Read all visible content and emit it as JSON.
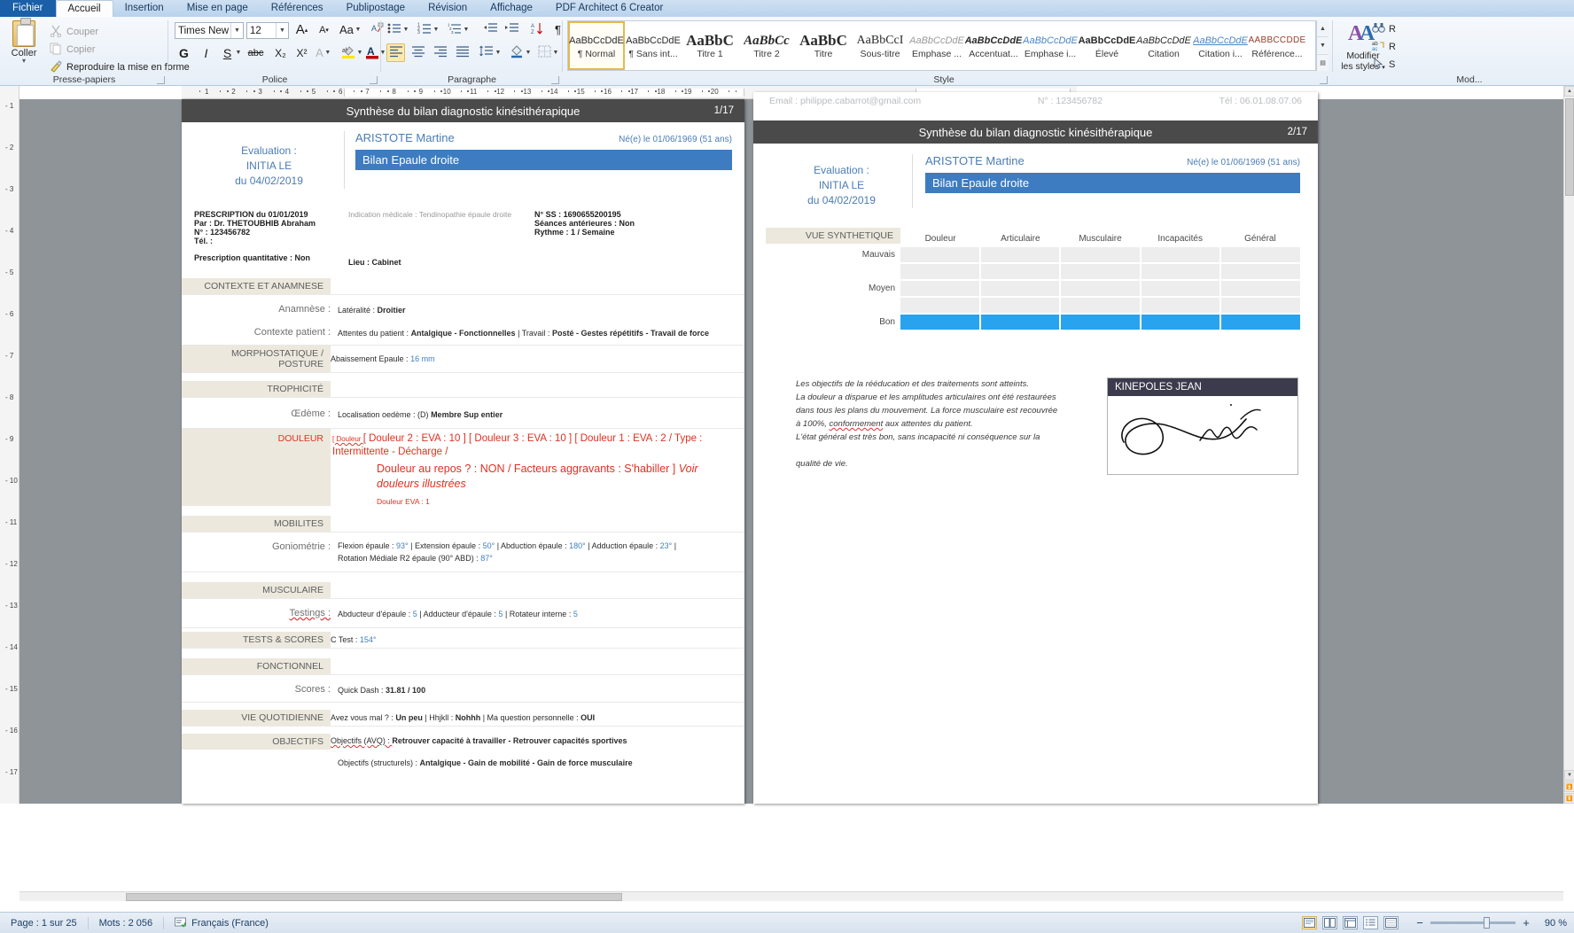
{
  "ribbon": {
    "tabs": [
      {
        "label": "Fichier",
        "kind": "file"
      },
      {
        "label": "Accueil",
        "kind": "active"
      },
      {
        "label": "Insertion",
        "kind": "normal"
      },
      {
        "label": "Mise en page",
        "kind": "normal"
      },
      {
        "label": "Références",
        "kind": "normal"
      },
      {
        "label": "Publipostage",
        "kind": "normal"
      },
      {
        "label": "Révision",
        "kind": "normal"
      },
      {
        "label": "Affichage",
        "kind": "normal"
      },
      {
        "label": "PDF Architect 6 Creator",
        "kind": "normal"
      }
    ],
    "clipboard": {
      "group_label": "Presse-papiers",
      "paste_label": "Coller",
      "cut_label": "Couper",
      "copy_label": "Copier",
      "format_painter_label": "Reproduire la mise en forme"
    },
    "font": {
      "group_label": "Police",
      "font_name": "Times New R",
      "font_size": "12",
      "grow_font": "A",
      "shrink_font": "A",
      "change_case": "Aa",
      "clear_format": "clear-formatting",
      "bold": "G",
      "italic": "I",
      "underline": "S",
      "strikethrough": "abc",
      "subscript": "X₂",
      "superscript": "X²",
      "text_effects": "A",
      "highlight": "ab",
      "font_color": "A"
    },
    "paragraph": {
      "group_label": "Paragraphe",
      "bullets": "bullet-list",
      "numbering": "numbered-list",
      "multilevel": "multilevel-list",
      "decrease_indent": "decrease-indent",
      "increase_indent": "increase-indent",
      "sort": "sort-az",
      "show_marks": "¶",
      "align_left": "align-left",
      "align_center": "align-center",
      "align_right": "align-right",
      "justify": "justify",
      "line_spacing": "line-spacing",
      "shading": "shading",
      "borders": "borders"
    },
    "styles": {
      "group_label": "Style",
      "modify_label_line1": "Modifier",
      "modify_label_line2": "les styles",
      "items": [
        {
          "preview": "AaBbCcDdE",
          "name": "¶ Normal",
          "selected": true
        },
        {
          "preview": "AaBbCcDdE",
          "name": "¶ Sans int...",
          "selected": false
        },
        {
          "preview": "AaBbC",
          "name": "Titre 1",
          "selected": false
        },
        {
          "preview": "AaBbCc",
          "name": "Titre 2",
          "selected": false
        },
        {
          "preview": "AaBbC",
          "name": "Titre",
          "selected": false
        },
        {
          "preview": "AaBbCcI",
          "name": "Sous-titre",
          "selected": false
        },
        {
          "preview": "AaBbCcDdE",
          "name": "Emphase ...",
          "selected": false
        },
        {
          "preview": "AaBbCcDdE",
          "name": "Accentuat...",
          "selected": false
        },
        {
          "preview": "AaBbCcDdE",
          "name": "Emphase i...",
          "selected": false
        },
        {
          "preview": "AaBbCcDdE",
          "name": "Élevé",
          "selected": false
        },
        {
          "preview": "AaBbCcDdE",
          "name": "Citation",
          "selected": false
        },
        {
          "preview": "AaBbCcDdE",
          "name": "Citation i...",
          "selected": false
        },
        {
          "preview": "AABBCCDDE",
          "name": "Référence...",
          "selected": false
        }
      ]
    },
    "editing": {
      "group_label": "Mod...",
      "find_label": "R",
      "replace_label": "R",
      "select_label": "S"
    }
  },
  "ruler": {
    "corner_tab": "L",
    "h_numbers": [
      "1",
      "2",
      "3",
      "4",
      "5",
      "6",
      "7",
      "8",
      "9",
      "10",
      "11",
      "12",
      "13",
      "14",
      "15",
      "16",
      "17",
      "18",
      "19",
      "20"
    ],
    "v_numbers": [
      "1",
      "2",
      "3",
      "4",
      "5",
      "6",
      "7",
      "8",
      "9",
      "10",
      "11",
      "12",
      "13",
      "14",
      "15",
      "16",
      "17"
    ]
  },
  "page1": {
    "header_title": "Synthèse du bilan diagnostic kinésithérapique",
    "page_number": "1/17",
    "evaluation": {
      "line1": "Evaluation :",
      "line2": "INITIA LE",
      "line3": "du 04/02/2019"
    },
    "patient_name": "ARISTOTE Martine",
    "born": "Né(e) le 01/06/1969 (51 ans)",
    "bilan": "Bilan Epaule droite",
    "prescription": {
      "line1": "PRESCRIPTION du 01/01/2019",
      "line2": "Par : Dr. THETOUBHIB Abraham",
      "line3": "N° : 123456782",
      "line4": "Tél. :",
      "line5": "Prescription quantitative : Non",
      "lieu": "Lieu : Cabinet",
      "indication": "Indication médicale : Tendinopathie épaule droite",
      "nss": "N° SS : 1690655200195",
      "seances": "Séances antérieures : Non",
      "rythme": "Rythme : 1 / Semaine"
    },
    "sections": {
      "contexte_title": "CONTEXTE  ET ANAMNESE",
      "anamnese_label": "Anamnèse :",
      "anamnese_value_plain": "Latéralité : ",
      "anamnese_value_bold": "Droitier",
      "contexte_label": "Contexte patient :",
      "contexte_value": "Attentes du patient : Antalgique - Fonctionnelles | Travail : Posté - Gestes répétitifs - Travail de force",
      "morpho_title": "MORPHOSTATIQUE / POSTURE",
      "morpho_value_plain": "Abaissement Epaule : ",
      "morpho_value_blue": "16 mm",
      "trophicite_title": "TROPHICITÉ",
      "oedeme_label": "Œdème :",
      "oedeme_value_plain": "Localisation oedème : (D) ",
      "oedeme_value_bold": "Membre Sup entier",
      "douleur_title": "DOULEUR",
      "douleur_line1": "[ Douleur 2 : EVA : 10 ] [ Douleur 3 : EVA : 10 ] [ Douleur 1 : EVA : 2 / Type :",
      "douleur_line2": "Intermittente - Décharge  /",
      "douleur_line3": "Douleur au repos ? : NON / Facteurs aggravants : S'habiller ] ",
      "douleur_line3_italic": "Voir",
      "douleur_line4_italic": "douleurs illustrées",
      "douleur_eva": "Douleur EVA : 1",
      "mobilites_title": "MOBILITES",
      "gonio_label": "Goniométrie :",
      "gonio_line1": [
        {
          "t": "Flexion épaule : ",
          "c": "plain"
        },
        {
          "t": "93°",
          "c": "blue"
        },
        {
          "t": " | Extension épaule : ",
          "c": "plain"
        },
        {
          "t": "50°",
          "c": "blue"
        },
        {
          "t": " | Abduction épaule : ",
          "c": "plain"
        },
        {
          "t": "180°",
          "c": "blue"
        },
        {
          "t": " | Adduction épaule : ",
          "c": "plain"
        },
        {
          "t": "23°",
          "c": "blue"
        },
        {
          "t": " |",
          "c": "plain"
        }
      ],
      "gonio_line2": [
        {
          "t": "Rotation Médiale R2 épaule (90° ABD) : ",
          "c": "plain"
        },
        {
          "t": "87°",
          "c": "blue"
        }
      ],
      "musculaire_title": "MUSCULAIRE",
      "testings_label": "Testings :",
      "testings_value": [
        {
          "t": "Abducteur d'épaule : ",
          "c": "plain"
        },
        {
          "t": "5",
          "c": "blue"
        },
        {
          "t": " | Adducteur d'épaule : ",
          "c": "plain"
        },
        {
          "t": "5",
          "c": "blue"
        },
        {
          "t": " | Rotateur interne : ",
          "c": "plain"
        },
        {
          "t": "5",
          "c": "blue"
        }
      ],
      "tests_title": "TESTS & SCORES",
      "tests_value_plain": "C Test : ",
      "tests_value_blue": "154°",
      "fonctionnel_title": "FONCTIONNEL",
      "scores_label": "Scores :",
      "scores_value_plain": "Quick Dash : ",
      "scores_value_bold": "31.81 / 100",
      "vie_title": "VIE QUOTIDIENNE",
      "vie_value": [
        {
          "t": "Avez vous mal ? : ",
          "c": "plain"
        },
        {
          "t": "Un peu",
          "c": "bold"
        },
        {
          "t": " | Hhjkll : ",
          "c": "plain"
        },
        {
          "t": "Nohhh",
          "c": "bold"
        },
        {
          "t": " | Ma question personnelle : ",
          "c": "plain"
        },
        {
          "t": "OUI",
          "c": "bold"
        }
      ],
      "objectifs_title": "OBJECTIFS",
      "objectifs_line1_plain": "Objectifs (AVQ) : ",
      "objectifs_line1_bold": "Retrouver capacité à travailler - Retrouver capacités sportives",
      "objectifs_line2_plain": "Objectifs (structurels) : ",
      "objectifs_line2_bold": "Antalgique - Gain de mobilité - Gain de force musculaire"
    }
  },
  "page2": {
    "faint_email": "Email : philippe.cabarrot@gmail.com",
    "faint_num": "N° : 123456782",
    "faint_tel": "Tél : 06.01.08.07.06",
    "header_title": "Synthèse du bilan diagnostic kinésithérapique",
    "page_number": "2/17",
    "evaluation": {
      "line1": "Evaluation :",
      "line2": "INITIA LE",
      "line3": "du 04/02/2019"
    },
    "patient_name": "ARISTOTE Martine",
    "born": "Né(e) le 01/06/1969 (51 ans)",
    "bilan": "Bilan Epaule droite",
    "synthese": {
      "title": "VUE SYNTHETIQUE",
      "columns": [
        "Douleur",
        "Articulaire",
        "Musculaire",
        "Incapacités",
        "Général"
      ],
      "rows": [
        {
          "label": "Mauvais",
          "cells": [
            "off",
            "off",
            "off",
            "off",
            "off"
          ]
        },
        {
          "label": "",
          "cells": [
            "off",
            "off",
            "off",
            "off",
            "off"
          ]
        },
        {
          "label": "Moyen",
          "cells": [
            "off",
            "off",
            "off",
            "off",
            "off"
          ]
        },
        {
          "label": "",
          "cells": [
            "off",
            "off",
            "off",
            "off",
            "off"
          ]
        },
        {
          "label": "Bon",
          "cells": [
            "on",
            "on",
            "on",
            "on",
            "on"
          ]
        }
      ]
    },
    "conclusion": [
      "Les objectifs de la rééducation et des traitements sont atteints.",
      "La douleur a disparue et les amplitudes articulaires ont été restaurées",
      "dans tous les plans du mouvement. La force musculaire est recouvrée",
      "à 100%, conformement aux attentes du patient.",
      "L'état général est très bon, sans incapacité ni conséquence sur la",
      "",
      "qualité de vie."
    ],
    "signature_name": "KINEPOLES JEAN"
  },
  "status": {
    "page_info": "Page : 1 sur 25",
    "word_count": "Mots : 2 056",
    "language": "Français (France)",
    "zoom": "90 %",
    "zoom_minus": "−",
    "zoom_plus": "+"
  },
  "colors": {
    "accent_blue": "#3d7cc0",
    "bar_blue": "#2aa3ef",
    "header_grey": "#4a4a4a",
    "section_beige": "#ece8dd",
    "red": "#e03020",
    "text_blue": "#4a7cb5"
  }
}
